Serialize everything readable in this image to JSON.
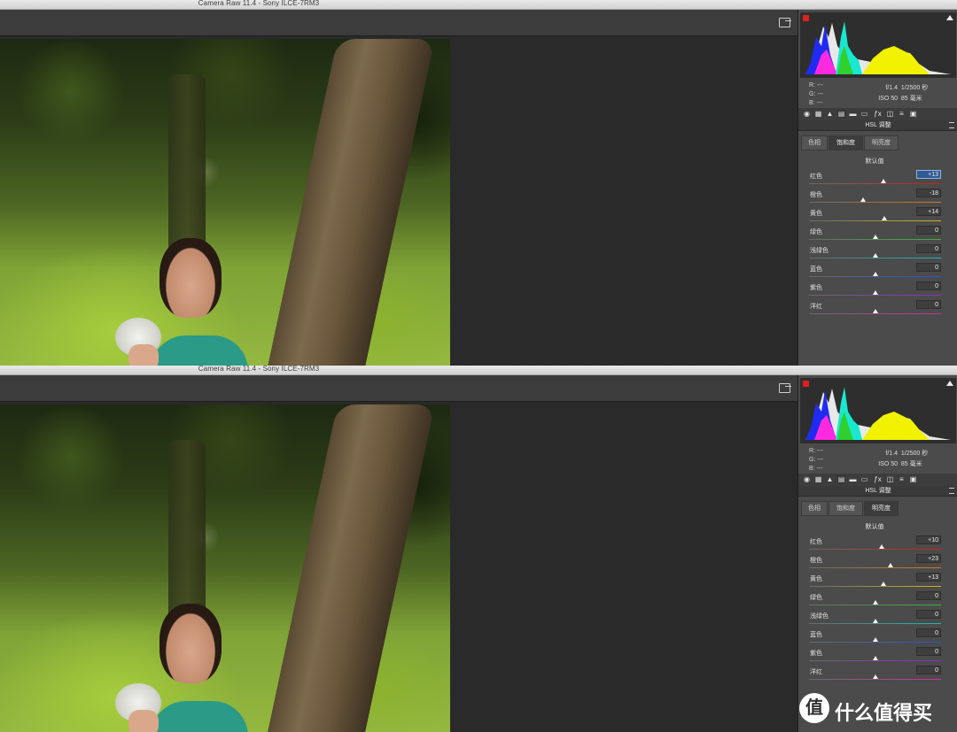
{
  "window_title": "Camera Raw 11.4 -  Sony ILCE-7RM3",
  "readout": {
    "r": "R:   ---",
    "g": "G:   ---",
    "b": "B:   ---"
  },
  "exif": {
    "aperture": "f/1.4",
    "shutter": "1/2500 秒",
    "iso": "ISO 50",
    "focal": "85 毫米"
  },
  "panel_title": "HSL 调整",
  "tabs": [
    "色相",
    "饱和度",
    "明亮度"
  ],
  "default_label": "默认值",
  "colors": {
    "tracks": [
      "#d01c1c",
      "#d9781c",
      "#c9b51c",
      "#3bb33b",
      "#1cb5b5",
      "#2454d0",
      "#8a2ad0",
      "#d02aa8"
    ],
    "focus": "#2f5b93"
  },
  "icons": [
    "basic-icon",
    "tone-curve-icon",
    "detail-icon",
    "hsl-icon",
    "split-toning-icon",
    "lens-icon",
    "effects-icon",
    "calibration-icon",
    "presets-icon",
    "snapshots-icon"
  ],
  "top": {
    "active_tab": 1,
    "sliders": [
      {
        "label": "红色",
        "value": "+13",
        "num": 13,
        "focused": true
      },
      {
        "label": "橙色",
        "value": "-18",
        "num": -18,
        "focused": false
      },
      {
        "label": "黄色",
        "value": "+14",
        "num": 14,
        "focused": false
      },
      {
        "label": "绿色",
        "value": "0",
        "num": 0,
        "focused": false
      },
      {
        "label": "浅绿色",
        "value": "0",
        "num": 0,
        "focused": false
      },
      {
        "label": "蓝色",
        "value": "0",
        "num": 0,
        "focused": false
      },
      {
        "label": "紫色",
        "value": "0",
        "num": 0,
        "focused": false
      },
      {
        "label": "洋红",
        "value": "0",
        "num": 0,
        "focused": false
      }
    ]
  },
  "bottom": {
    "active_tab": 2,
    "sliders": [
      {
        "label": "红色",
        "value": "+10",
        "num": 10,
        "focused": false
      },
      {
        "label": "橙色",
        "value": "+23",
        "num": 23,
        "focused": false
      },
      {
        "label": "黄色",
        "value": "+13",
        "num": 13,
        "focused": false
      },
      {
        "label": "绿色",
        "value": "0",
        "num": 0,
        "focused": false
      },
      {
        "label": "浅绿色",
        "value": "0",
        "num": 0,
        "focused": false
      },
      {
        "label": "蓝色",
        "value": "0",
        "num": 0,
        "focused": false
      },
      {
        "label": "紫色",
        "value": "0",
        "num": 0,
        "focused": false
      },
      {
        "label": "洋红",
        "value": "0",
        "num": 0,
        "focused": false
      }
    ]
  },
  "watermark": {
    "logo": "值",
    "text": "什么值得买"
  }
}
